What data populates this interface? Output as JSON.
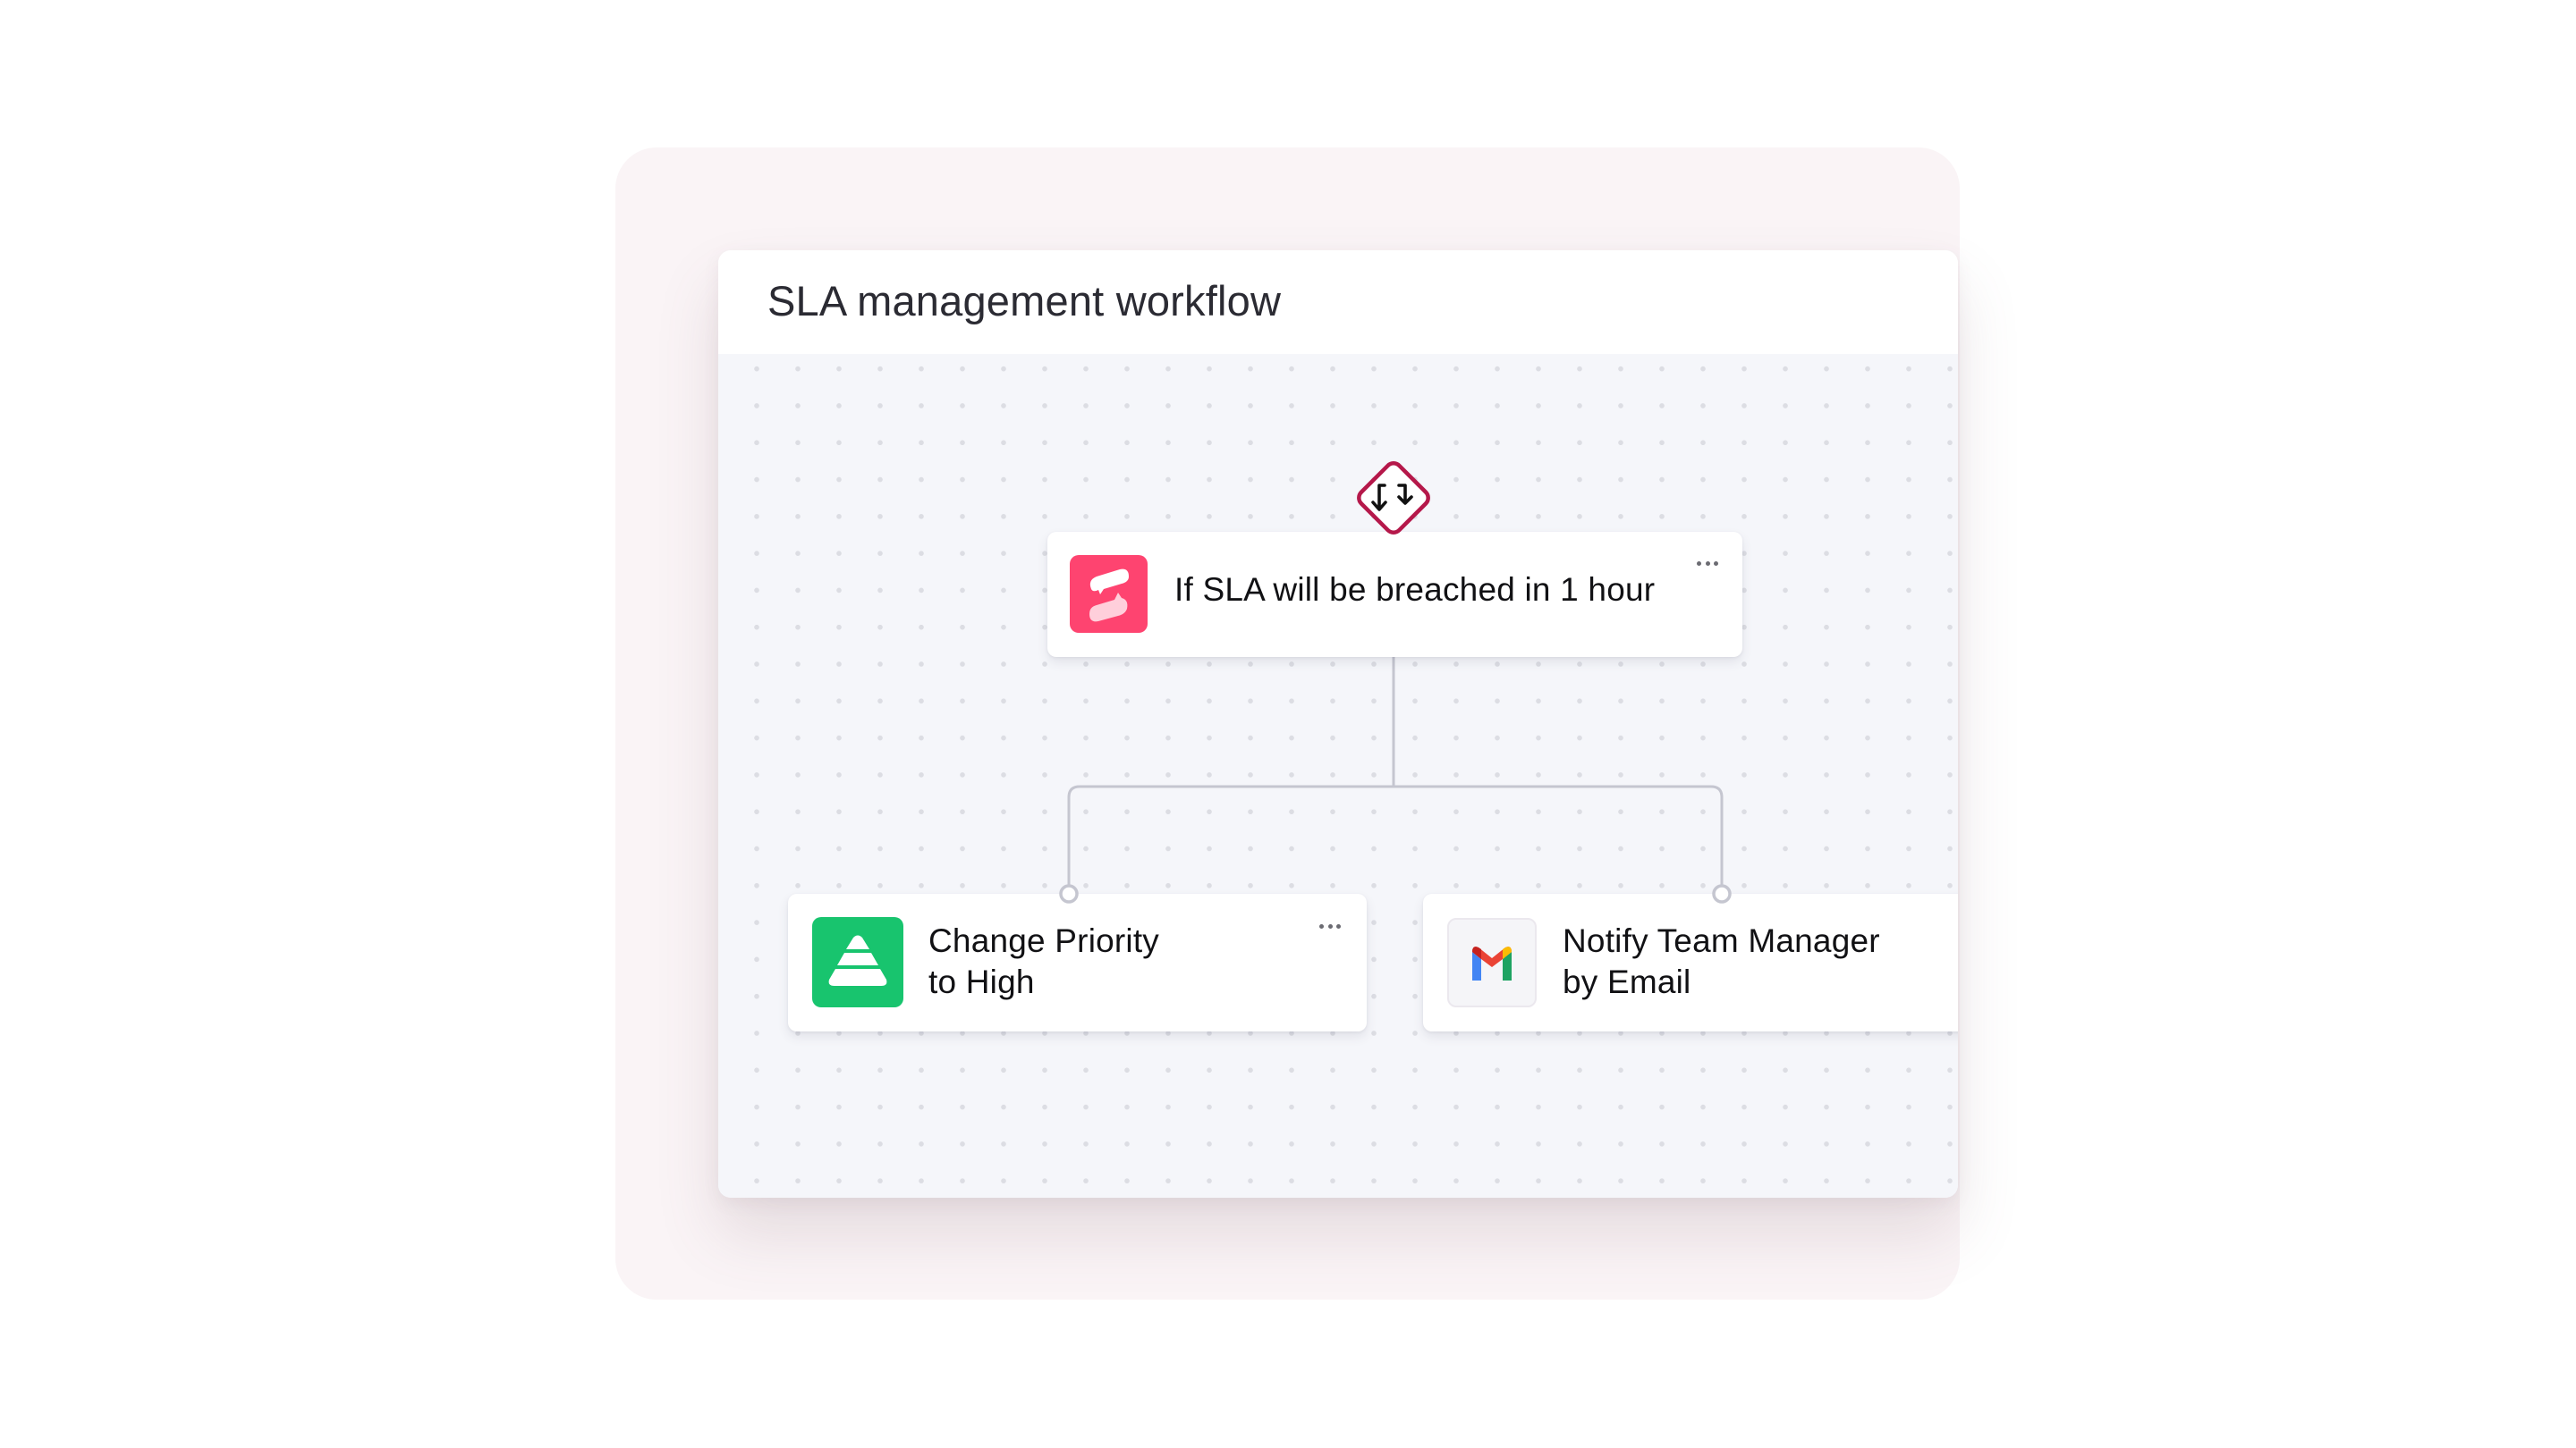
{
  "window": {
    "title": "SLA management workflow"
  },
  "workflow": {
    "condition_badge": {
      "icon": "branch-arrows-icon",
      "color": "#b5184a"
    },
    "trigger": {
      "label": "If SLA will be breached in 1 hour",
      "icon": "sla-app-icon",
      "icon_color": "#fe4470",
      "menu": "more-options"
    },
    "actions": [
      {
        "label_line1": "Change Priority",
        "label_line2": "to High",
        "icon": "priority-pyramid-icon",
        "icon_color": "#18c46e",
        "menu": "more-options"
      },
      {
        "label_line1": "Notify Team Manager",
        "label_line2": "by Email",
        "icon": "gmail-icon",
        "icon_color": "#f5f5f8"
      }
    ],
    "connector_color": "#c5c6d0"
  },
  "colors": {
    "backdrop": "#faf4f6",
    "canvas": "#f5f6fa",
    "header": "#ffffff",
    "text": "#111114"
  }
}
